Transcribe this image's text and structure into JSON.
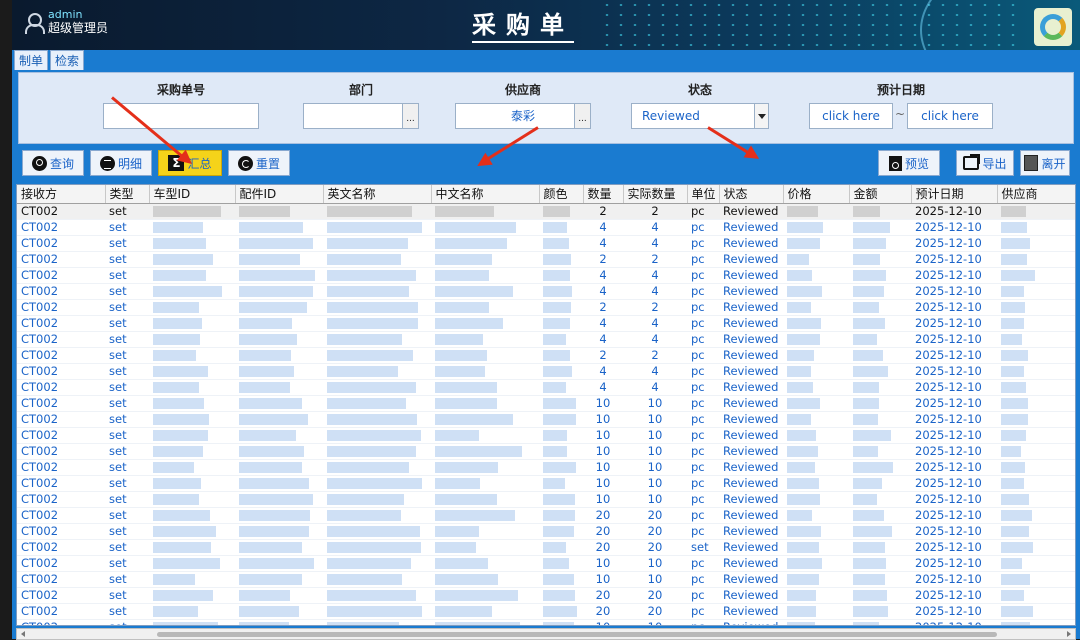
{
  "header": {
    "user_name": "admin",
    "user_role": "超级管理员",
    "title": "采购单"
  },
  "tabs": [
    {
      "label": "制单"
    },
    {
      "label": "检索"
    }
  ],
  "filters": {
    "order_no": {
      "label": "采购单号",
      "value": ""
    },
    "dept": {
      "label": "部门",
      "value": ""
    },
    "supplier": {
      "label": "供应商",
      "value": "泰彩"
    },
    "status": {
      "label": "状态",
      "value": "Reviewed"
    },
    "date": {
      "label": "预计日期",
      "from": "click here",
      "sep": "~",
      "to": "click here"
    }
  },
  "toolbar": {
    "query": "查询",
    "detail": "明细",
    "summary": "汇总",
    "reset": "重置",
    "preview": "预览",
    "export": "导出",
    "exit": "离开"
  },
  "table": {
    "columns": [
      "接收方",
      "类型",
      "车型ID",
      "配件ID",
      "英文名称",
      "中文名称",
      "颜色",
      "数量",
      "实际数量",
      "单位",
      "状态",
      "价格",
      "金额",
      "预计日期",
      "供应商"
    ],
    "rows": [
      [
        "CT002",
        "set",
        "2",
        "2",
        "pc",
        "Reviewed",
        "2025-12-10"
      ],
      [
        "CT002",
        "set",
        "4",
        "4",
        "pc",
        "Reviewed",
        "2025-12-10"
      ],
      [
        "CT002",
        "set",
        "4",
        "4",
        "pc",
        "Reviewed",
        "2025-12-10"
      ],
      [
        "CT002",
        "set",
        "2",
        "2",
        "pc",
        "Reviewed",
        "2025-12-10"
      ],
      [
        "CT002",
        "set",
        "4",
        "4",
        "pc",
        "Reviewed",
        "2025-12-10"
      ],
      [
        "CT002",
        "set",
        "4",
        "4",
        "pc",
        "Reviewed",
        "2025-12-10"
      ],
      [
        "CT002",
        "set",
        "2",
        "2",
        "pc",
        "Reviewed",
        "2025-12-10"
      ],
      [
        "CT002",
        "set",
        "4",
        "4",
        "pc",
        "Reviewed",
        "2025-12-10"
      ],
      [
        "CT002",
        "set",
        "4",
        "4",
        "pc",
        "Reviewed",
        "2025-12-10"
      ],
      [
        "CT002",
        "set",
        "2",
        "2",
        "pc",
        "Reviewed",
        "2025-12-10"
      ],
      [
        "CT002",
        "set",
        "4",
        "4",
        "pc",
        "Reviewed",
        "2025-12-10"
      ],
      [
        "CT002",
        "set",
        "4",
        "4",
        "pc",
        "Reviewed",
        "2025-12-10"
      ],
      [
        "CT002",
        "set",
        "10",
        "10",
        "pc",
        "Reviewed",
        "2025-12-10"
      ],
      [
        "CT002",
        "set",
        "10",
        "10",
        "pc",
        "Reviewed",
        "2025-12-10"
      ],
      [
        "CT002",
        "set",
        "10",
        "10",
        "pc",
        "Reviewed",
        "2025-12-10"
      ],
      [
        "CT002",
        "set",
        "10",
        "10",
        "pc",
        "Reviewed",
        "2025-12-10"
      ],
      [
        "CT002",
        "set",
        "10",
        "10",
        "pc",
        "Reviewed",
        "2025-12-10"
      ],
      [
        "CT002",
        "set",
        "10",
        "10",
        "pc",
        "Reviewed",
        "2025-12-10"
      ],
      [
        "CT002",
        "set",
        "10",
        "10",
        "pc",
        "Reviewed",
        "2025-12-10"
      ],
      [
        "CT002",
        "set",
        "20",
        "20",
        "pc",
        "Reviewed",
        "2025-12-10"
      ],
      [
        "CT002",
        "set",
        "20",
        "20",
        "pc",
        "Reviewed",
        "2025-12-10"
      ],
      [
        "CT002",
        "set",
        "20",
        "20",
        "set",
        "Reviewed",
        "2025-12-10"
      ],
      [
        "CT002",
        "set",
        "10",
        "10",
        "pc",
        "Reviewed",
        "2025-12-10"
      ],
      [
        "CT002",
        "set",
        "10",
        "10",
        "pc",
        "Reviewed",
        "2025-12-10"
      ],
      [
        "CT002",
        "set",
        "20",
        "20",
        "pc",
        "Reviewed",
        "2025-12-10"
      ],
      [
        "CT002",
        "set",
        "20",
        "20",
        "pc",
        "Reviewed",
        "2025-12-10"
      ],
      [
        "CT002",
        "set",
        "10",
        "10",
        "pc",
        "Reviewed",
        "2025-12-10"
      ]
    ]
  },
  "colors": {
    "header_bg": "#0d2744",
    "body_blue": "#1a7bd0",
    "text_blue": "#1a63c8",
    "highlight_yellow": "#f5d31a",
    "annotation_red": "#e42f1a"
  }
}
